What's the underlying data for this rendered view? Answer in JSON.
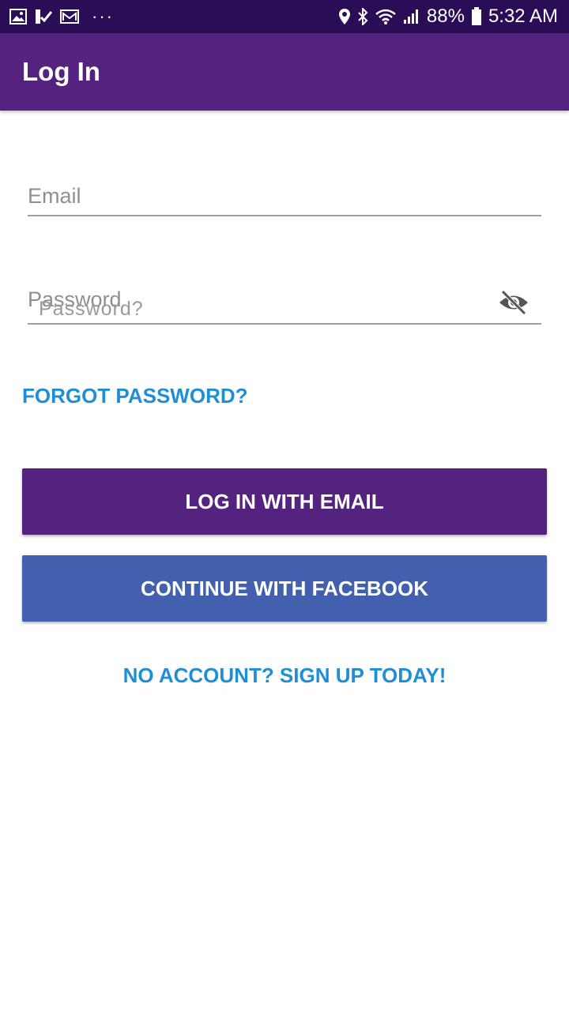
{
  "status_bar": {
    "left_icons": [
      "gallery-icon",
      "checkmark-notification-icon",
      "mail-icon",
      "more-notifications-icon"
    ],
    "right_icons": [
      "location-icon",
      "bluetooth-icon",
      "wifi-icon",
      "signal-icon",
      "battery-icon"
    ],
    "battery": "88%",
    "time": "5:32 AM"
  },
  "app_bar": {
    "title": "Log In"
  },
  "form": {
    "email_placeholder": "Email",
    "password_label": "Password",
    "password_hint_ghost": "Password?",
    "password_visibility_icon": "eye-off-icon"
  },
  "links": {
    "forgot_password": "FORGOT PASSWORD?",
    "sign_up": "NO ACCOUNT? SIGN UP TODAY!"
  },
  "buttons": {
    "email_login": "LOG IN WITH EMAIL",
    "facebook": "CONTINUE WITH FACEBOOK"
  },
  "colors": {
    "status_bar": "#2a0d57",
    "primary": "#53237f",
    "facebook": "#4260ae",
    "link": "#1e8fd6"
  }
}
